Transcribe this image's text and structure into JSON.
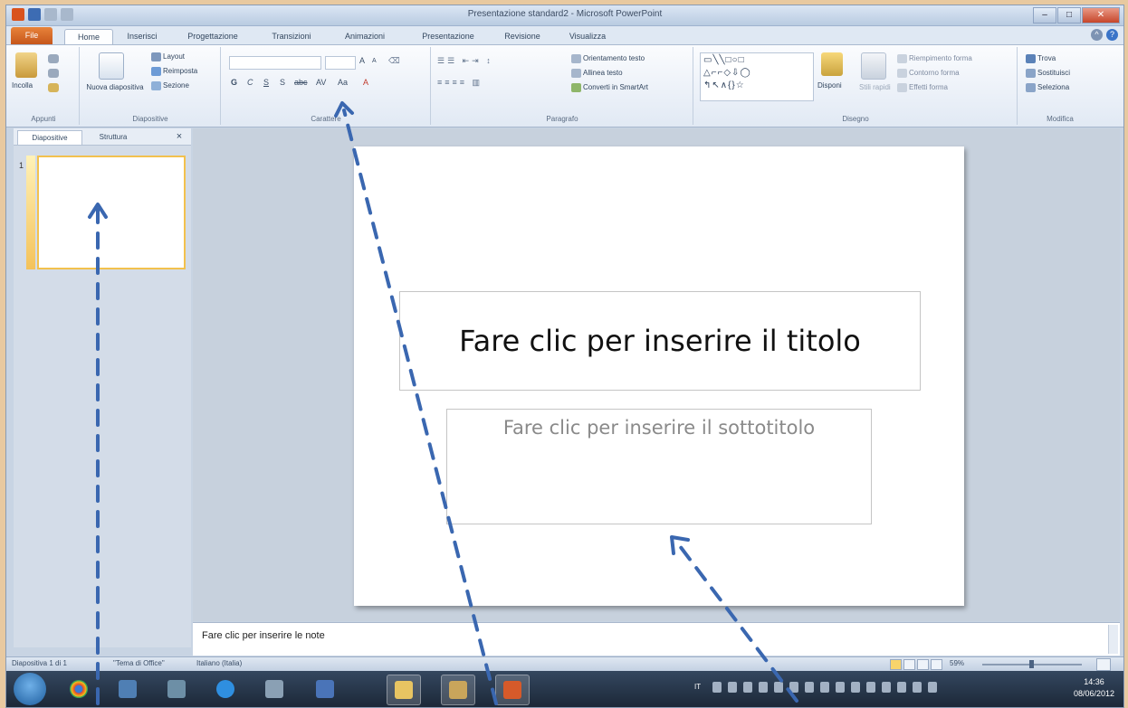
{
  "window": {
    "title": "Presentazione standard2 - Microsoft PowerPoint",
    "controls": {
      "minimize": "–",
      "maximize": "□",
      "close": "✕"
    }
  },
  "ribbon_tabs": [
    {
      "label": "File"
    },
    {
      "label": "Home"
    },
    {
      "label": "Inserisci"
    },
    {
      "label": "Progettazione"
    },
    {
      "label": "Transizioni"
    },
    {
      "label": "Animazioni"
    },
    {
      "label": "Presentazione"
    },
    {
      "label": "Revisione"
    },
    {
      "label": "Visualizza"
    }
  ],
  "ribbon": {
    "clipboard": {
      "label": "Appunti",
      "paste": "Incolla"
    },
    "slides": {
      "label": "Diapositive",
      "new_slide": "Nuova diapositiva",
      "layout": "Layout",
      "reset": "Reimposta",
      "section": "Sezione"
    },
    "font": {
      "label": "Carattere",
      "grow": "A",
      "shrink": "A",
      "bold": "G",
      "italic": "C",
      "underline": "S",
      "shadow": "S",
      "strike": "abc",
      "spacing": "AV",
      "case": "Aa",
      "color": "A"
    },
    "paragraph": {
      "label": "Paragrafo",
      "text_direction": "Orientamento testo",
      "align_text": "Allinea testo",
      "smartart": "Converti in SmartArt"
    },
    "drawing": {
      "label": "Disegno",
      "arrange": "Disponi",
      "quick_styles": "Stili rapidi",
      "fill": "Riempimento forma",
      "outline": "Contorno forma",
      "effects": "Effetti forma"
    },
    "editing": {
      "label": "Modifica",
      "find": "Trova",
      "replace": "Sostituisci",
      "select": "Seleziona"
    }
  },
  "left_pane": {
    "tabs": [
      {
        "label": "Diapositive"
      },
      {
        "label": "Struttura"
      }
    ],
    "close": "×",
    "slide_number": "1"
  },
  "slide": {
    "title_placeholder": "Fare clic per inserire il titolo",
    "subtitle_placeholder": "Fare clic per inserire il sottotitolo"
  },
  "notes": {
    "placeholder": "Fare clic per inserire le note"
  },
  "statusbar": {
    "slide_count": "Diapositiva 1 di 1",
    "theme": "\"Tema di Office\"",
    "language": "Italiano (Italia)",
    "zoom": "59%"
  },
  "taskbar": {
    "time": "14:36",
    "date": "08/06/2012",
    "lang": "IT"
  },
  "colors": {
    "file_tab": "#d0621f",
    "annotation_arrow": "#3a67b0",
    "slide_selection": "#f2c14e"
  }
}
